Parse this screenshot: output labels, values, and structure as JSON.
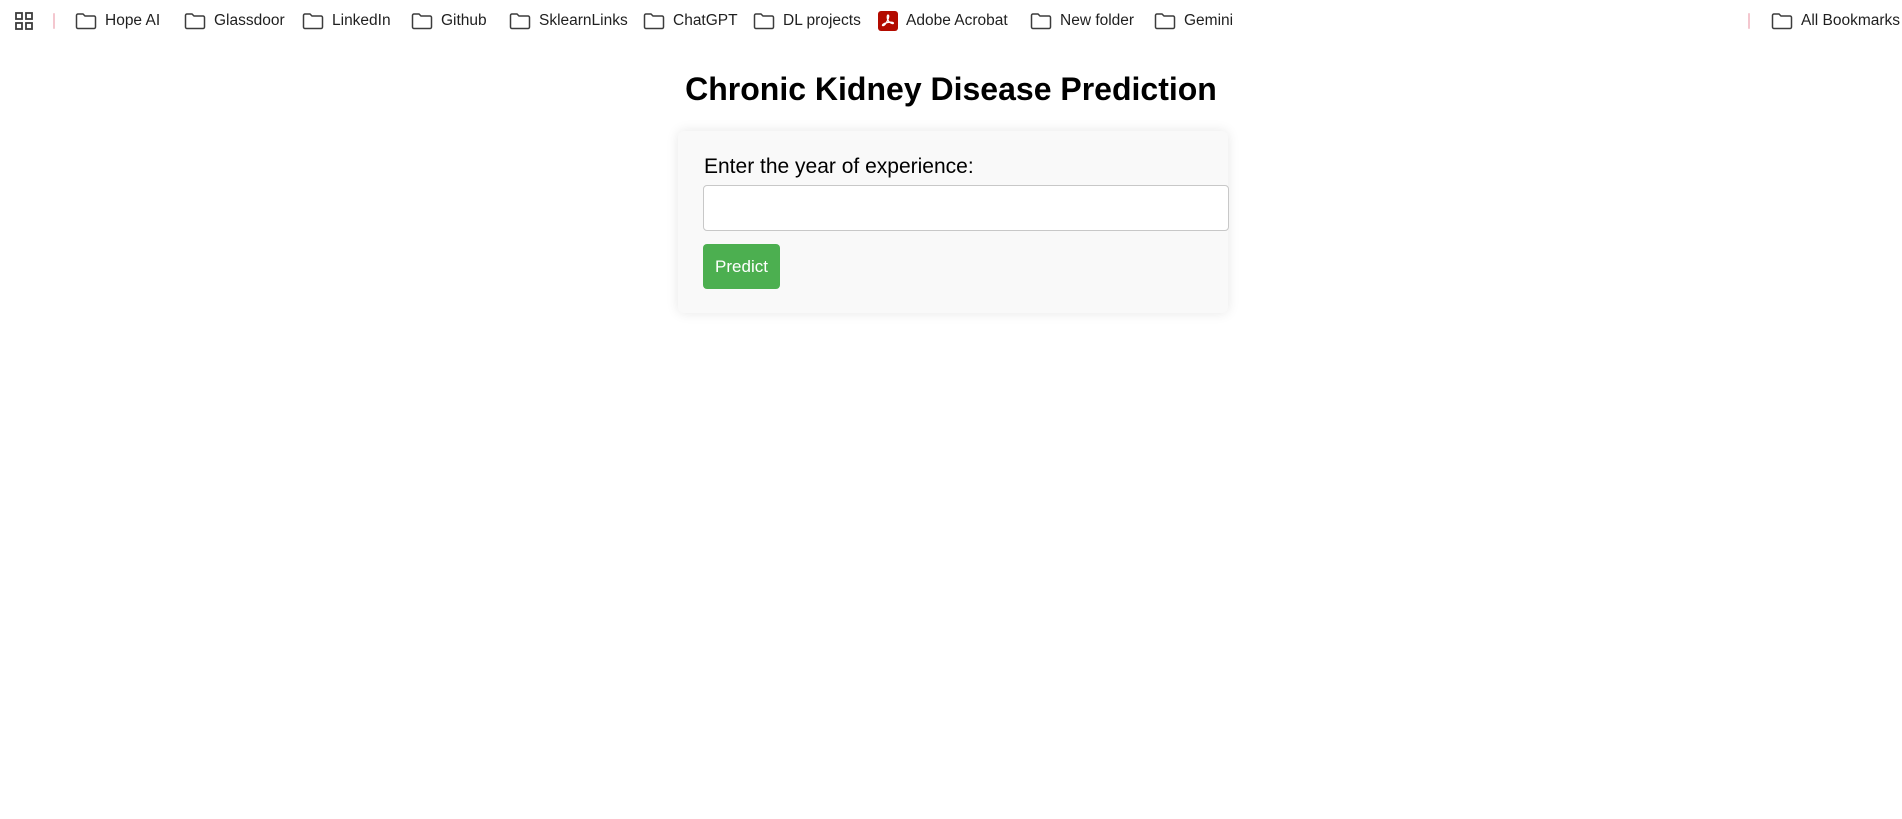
{
  "bookmarks_bar": {
    "apps_icon": "apps-grid-icon",
    "items": [
      {
        "label": "Hope AI",
        "icon": "folder-icon"
      },
      {
        "label": "Glassdoor",
        "icon": "folder-icon"
      },
      {
        "label": "LinkedIn",
        "icon": "folder-icon"
      },
      {
        "label": "Github",
        "icon": "folder-icon"
      },
      {
        "label": "SklearnLinks",
        "icon": "folder-icon"
      },
      {
        "label": "ChatGPT",
        "icon": "folder-icon"
      },
      {
        "label": "DL projects",
        "icon": "folder-icon"
      },
      {
        "label": "Adobe Acrobat",
        "icon": "adobe-acrobat-icon"
      },
      {
        "label": "New folder",
        "icon": "folder-icon"
      },
      {
        "label": "Gemini",
        "icon": "folder-icon"
      }
    ],
    "all_bookmarks": {
      "label": "All Bookmarks",
      "icon": "folder-icon"
    }
  },
  "main": {
    "title": "Chronic Kidney Disease Prediction",
    "form": {
      "label": "Enter the year of experience:",
      "input_value": "",
      "button_label": "Predict"
    }
  },
  "colors": {
    "button_bg": "#4caf50",
    "card_bg": "#f9f9f9",
    "separator": "#f4c7cf",
    "acrobat_red": "#b30b00"
  }
}
